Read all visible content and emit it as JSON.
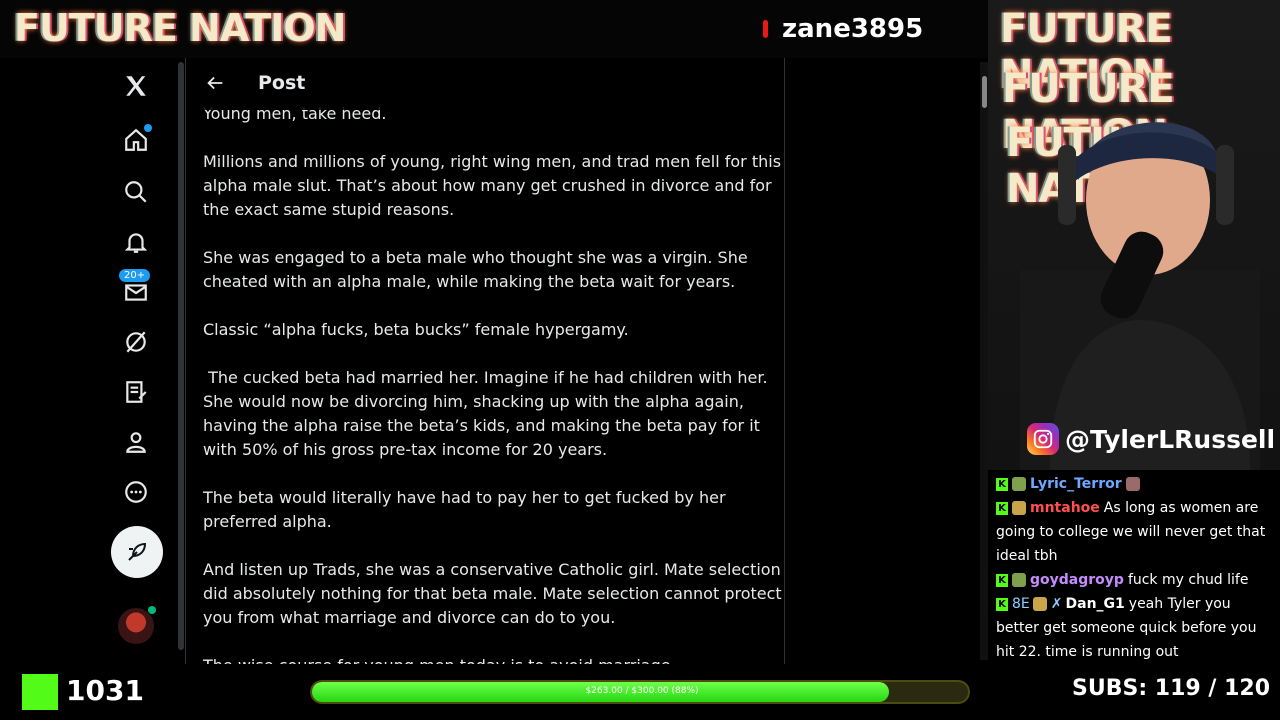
{
  "stream": {
    "brand": "FUTURE NATION",
    "viewer_name": "zane3895",
    "kick_followers": "1031",
    "goal_label": "$263.00 / $300.00 (88%)",
    "goal_fraction": 0.88,
    "subs_label": "SUBS:",
    "subs_value": "119 / 120",
    "instagram": "@TylerLRussell",
    "cam_titles": [
      "FUTURE NATION",
      "FUTURE NATION",
      "FUTURE NATION"
    ]
  },
  "nav": {
    "items": [
      {
        "name": "x-logo"
      },
      {
        "name": "home"
      },
      {
        "name": "explore"
      },
      {
        "name": "notifications"
      },
      {
        "name": "messages",
        "badge": "20+"
      },
      {
        "name": "grok"
      },
      {
        "name": "lists"
      },
      {
        "name": "profile"
      },
      {
        "name": "more"
      }
    ]
  },
  "post": {
    "header": "Post",
    "paragraphs": [
      "Young men, take heed.",
      "Millions and millions of young, right wing men, and trad men fell for this alpha male slut. That’s about how many get crushed in divorce and for the exact same stupid reasons.",
      "She was engaged to a beta male who thought she was a virgin. She cheated with an alpha male, while making the beta wait for years.",
      "Classic “alpha fucks, beta bucks” female hypergamy.",
      " The cucked beta had married her. Imagine if he had children with her. She would now be divorcing him, shacking up with the alpha again, having the alpha raise the beta’s kids, and making the beta pay for it with 50% of his gross pre-tax income for 20 years.",
      "The beta would literally have had to pay her to get fucked by her preferred alpha.",
      "And listen up Trads, she was a conservative Catholic girl. Mate selection did absolutely nothing for that beta male. Mate selection cannot protect you from what marriage and divorce can do to you.",
      "The wise course for young men today is to avoid marriage."
    ]
  },
  "chat": {
    "messages": [
      {
        "user": "Lyric_Terror",
        "color": "#6fa8ff",
        "text": ""
      },
      {
        "user": "mntahoe",
        "color": "#ff4f4f",
        "text": "As long as women are going to college we will never get that ideal tbh"
      },
      {
        "user": "goydagroyp",
        "color": "#c58cff",
        "text": "fuck my chud life"
      },
      {
        "user": "Dan_G1",
        "color": "#ffffff",
        "prefix": "8E",
        "text": "yeah Tyler you better get someone quick before you hit 22. time is running out"
      }
    ]
  },
  "colors": {
    "accent": "#1d9bf0",
    "kick_green": "#53fc18",
    "live_red": "#e91916"
  }
}
